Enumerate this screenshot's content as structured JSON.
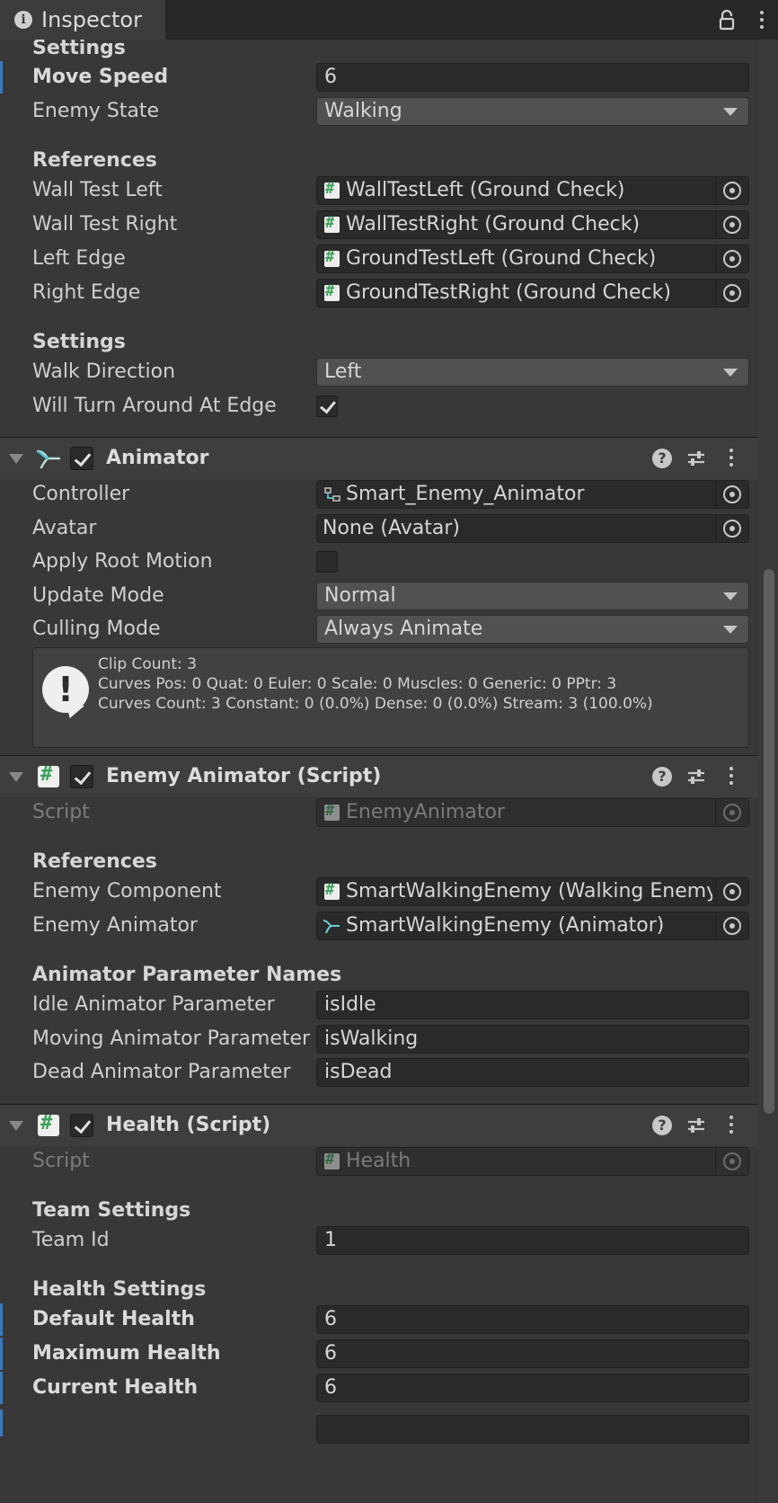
{
  "window": {
    "tab_title": "Inspector",
    "info_icon": "i"
  },
  "walking_enemy": {
    "settings_header": "Settings",
    "move_speed_label": "Move Speed",
    "move_speed_value": "6",
    "enemy_state_label": "Enemy State",
    "enemy_state_value": "Walking",
    "references_header": "References",
    "wall_test_left_label": "Wall Test Left",
    "wall_test_left_value": "WallTestLeft (Ground Check)",
    "wall_test_right_label": "Wall Test Right",
    "wall_test_right_value": "WallTestRight (Ground Check)",
    "left_edge_label": "Left Edge",
    "left_edge_value": "GroundTestLeft (Ground Check)",
    "right_edge_label": "Right Edge",
    "right_edge_value": "GroundTestRight (Ground Check)",
    "settings2_header": "Settings",
    "walk_direction_label": "Walk Direction",
    "walk_direction_value": "Left",
    "turn_around_label": "Will Turn Around At Edge",
    "turn_around_checked": true
  },
  "animator": {
    "title": "Animator",
    "enabled": true,
    "controller_label": "Controller",
    "controller_value": "Smart_Enemy_Animator",
    "avatar_label": "Avatar",
    "avatar_value": "None (Avatar)",
    "apply_root_motion_label": "Apply Root Motion",
    "apply_root_motion_checked": false,
    "update_mode_label": "Update Mode",
    "update_mode_value": "Normal",
    "culling_mode_label": "Culling Mode",
    "culling_mode_value": "Always Animate",
    "info_lines": [
      "Clip Count: 3",
      "Curves Pos: 0 Quat: 0 Euler: 0 Scale: 0 Muscles: 0 Generic: 0 PPtr: 3",
      "Curves Count: 3 Constant: 0 (0.0%) Dense: 0 (0.0%) Stream: 3 (100.0%)"
    ]
  },
  "enemy_animator": {
    "title": "Enemy Animator (Script)",
    "enabled": true,
    "script_label": "Script",
    "script_value": "EnemyAnimator",
    "references_header": "References",
    "enemy_component_label": "Enemy Component",
    "enemy_component_value": "SmartWalkingEnemy (Walking Enemy)",
    "enemy_animator_label": "Enemy Animator",
    "enemy_animator_value": "SmartWalkingEnemy (Animator)",
    "param_header": "Animator Parameter Names",
    "idle_label": "Idle Animator Parameter",
    "idle_value": "isIdle",
    "moving_label": "Moving Animator Parameter",
    "moving_value": "isWalking",
    "dead_label": "Dead Animator Parameter",
    "dead_value": "isDead"
  },
  "health": {
    "title": "Health (Script)",
    "enabled": true,
    "script_label": "Script",
    "script_value": "Health",
    "team_header": "Team Settings",
    "team_id_label": "Team Id",
    "team_id_value": "1",
    "health_header": "Health Settings",
    "default_health_label": "Default Health",
    "default_health_value": "6",
    "max_health_label": "Maximum Health",
    "max_health_value": "6",
    "current_health_label": "Current Health",
    "current_health_value": "6"
  },
  "colors": {
    "accent_override": "#3a79bb",
    "script_icon": "#3aa05a",
    "background": "#383838"
  },
  "icons": {
    "lock": "lock-icon",
    "menu": "kebab-menu-icon",
    "help": "help-icon",
    "presets": "presets-icon",
    "picker": "object-picker-icon"
  }
}
